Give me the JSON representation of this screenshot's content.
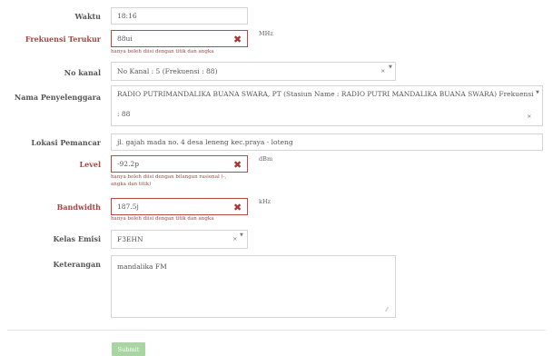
{
  "form": {
    "waktu": {
      "label": "Waktu",
      "value": "18:16"
    },
    "frekuensi": {
      "label": "Frekuensi Terukur",
      "value": "88ui",
      "unit": "MHz",
      "help": "hanya boleh diisi dengan titik dan angka"
    },
    "no_kanal": {
      "label": "No kanal",
      "value": "No Kanal : 5 (Frekuensi : 88)"
    },
    "penyelenggara": {
      "label": "Nama Penyelenggara",
      "line1": "RADIO PUTRIMANDALIKA BUANA SWARA, PT (Stasiun Name : RADIO PUTRI MANDALIKA BUANA SWARA) Frekuensi",
      "line2": ": 88"
    },
    "lokasi": {
      "label": "Lokasi Pemancar",
      "value": "jl. gajah mada  no. 4 desa leneng kec.praya - loteng"
    },
    "level": {
      "label": "Level",
      "value": "-92.2p",
      "unit": "dBm",
      "help_line1": "hanya boleh diisi dengan bilangan rasional (-,",
      "help_line2": "angka dan titik)"
    },
    "bandwidth": {
      "label": "Bandwidth",
      "value": "187.5j",
      "unit": "kHz",
      "help": "hanya boleh diisi dengan titik dan angka"
    },
    "kelas_emisi": {
      "label": "Kelas Emisi",
      "value": "F3EHN"
    },
    "keterangan": {
      "label": "Keterangan",
      "value": "mandalika FM"
    },
    "submit_label": "Submit"
  },
  "glyphs": {
    "error_x": "✖",
    "clear_x": "×",
    "arrow": "▼",
    "resize": "⁄⁄"
  },
  "colors": {
    "error": "#a94442",
    "submit_bg": "#a8d5a1",
    "border": "#d5d5d5"
  }
}
